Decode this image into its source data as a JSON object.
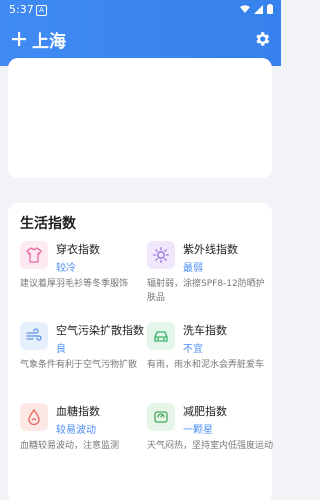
{
  "status": {
    "time": "5:37",
    "app_badge": "A"
  },
  "header": {
    "city": "上海"
  },
  "life": {
    "title": "生活指数",
    "items": [
      {
        "name": "穿衣指数",
        "level": "较冷",
        "desc": "建议着厚羽毛衫等冬季服饰",
        "icon": "shirt-icon",
        "bg": "#fde9f1",
        "fg": "#ea6a9a"
      },
      {
        "name": "紫外线指数",
        "level": "最弱",
        "desc": "辐射弱，涂擦SPF8-12防晒护肤品",
        "icon": "sun-icon",
        "bg": "#efe7fb",
        "fg": "#9b6fe0"
      },
      {
        "name": "空气污染扩散指数",
        "level": "良",
        "desc": "气象条件有利于空气污物扩散",
        "icon": "wind-icon",
        "bg": "#e6effc",
        "fg": "#5b8fe6"
      },
      {
        "name": "洗车指数",
        "level": "不宜",
        "desc": "有雨，雨水和泥水会弄脏爱车",
        "icon": "car-icon",
        "bg": "#e4f6ea",
        "fg": "#3ab36a"
      },
      {
        "name": "血糖指数",
        "level": "较易波动",
        "desc": "血糖较易波动，注意监测",
        "icon": "blood-drop-icon",
        "bg": "#fde8e6",
        "fg": "#e5655a"
      },
      {
        "name": "减肥指数",
        "level": "一颗星",
        "desc": "天气闷热，坚持室内低强度运动",
        "icon": "scale-icon",
        "bg": "#e6f5e8",
        "fg": "#4aa85f"
      }
    ]
  }
}
